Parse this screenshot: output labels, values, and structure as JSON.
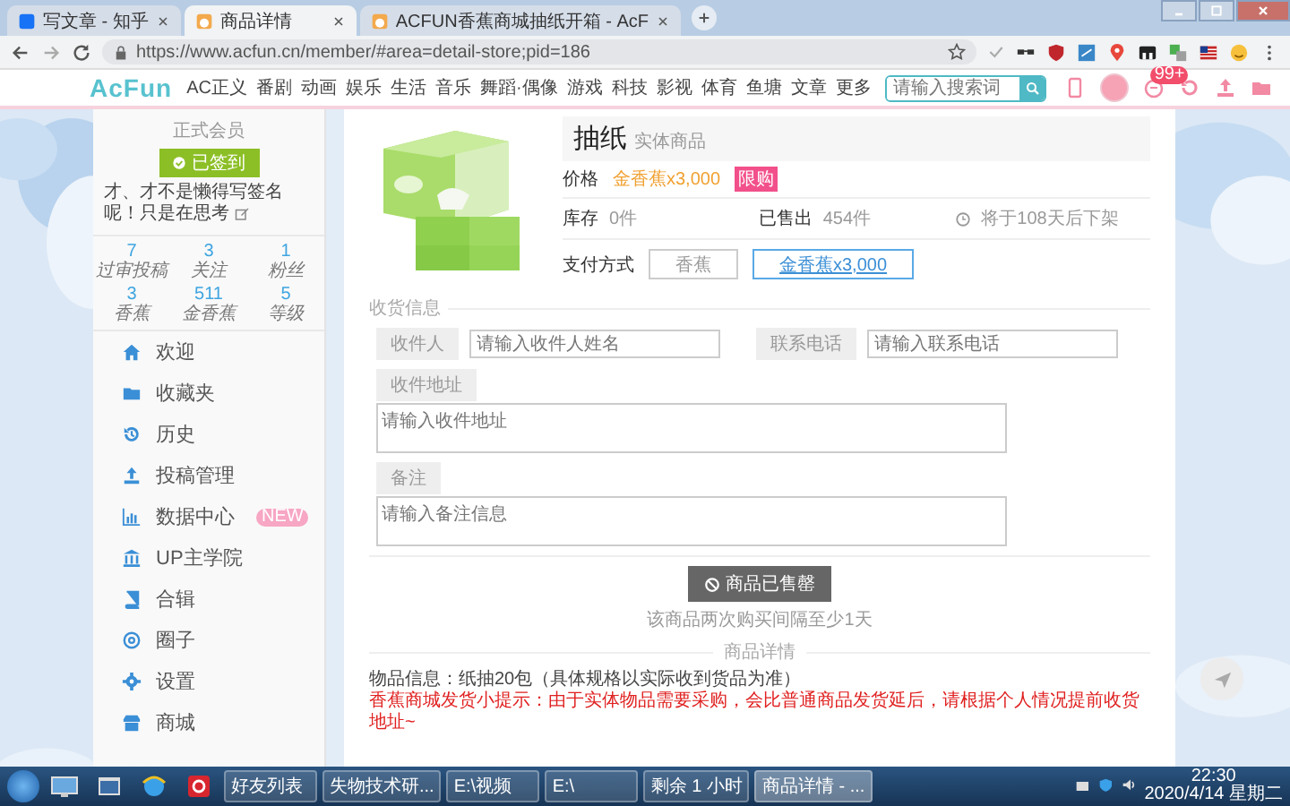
{
  "browser": {
    "tabs": [
      {
        "label": "写文章 - 知乎",
        "selected": false
      },
      {
        "label": "商品详情",
        "selected": true
      },
      {
        "label": "ACFUN香蕉商城抽纸开箱 - AcF",
        "selected": false
      }
    ],
    "url": "https://www.acfun.cn/member/#area=detail-store;pid=186"
  },
  "site_nav": {
    "logo": "AcFun",
    "items": [
      "AC正义",
      "番剧",
      "动画",
      "娱乐",
      "生活",
      "音乐",
      "舞蹈·偶像",
      "游戏",
      "科技",
      "影视",
      "体育",
      "鱼塘",
      "文章",
      "更多"
    ],
    "search": {
      "placeholder": "请输入搜索词"
    },
    "message_badge": "99+"
  },
  "sidebar": {
    "member_level": "正式会员",
    "checkin_button": "已签到",
    "bio": "才、才不是懒得写签名呢！只是在思考",
    "stats": [
      {
        "value": "7",
        "label": "过审投稿"
      },
      {
        "value": "3",
        "label": "关注"
      },
      {
        "value": "1",
        "label": "粉丝"
      },
      {
        "value": "3",
        "label": "香蕉"
      },
      {
        "value": "511",
        "label": "金香蕉"
      },
      {
        "value": "5",
        "label": "等级"
      }
    ],
    "menu": [
      {
        "label": "欢迎"
      },
      {
        "label": "收藏夹"
      },
      {
        "label": "历史"
      },
      {
        "label": "投稿管理"
      },
      {
        "label": "数据中心",
        "badge": "NEW"
      },
      {
        "label": "UP主学院"
      },
      {
        "label": "合辑"
      },
      {
        "label": "圈子"
      },
      {
        "label": "设置"
      },
      {
        "label": "商城"
      }
    ]
  },
  "product": {
    "title": "抽纸",
    "tag": "实体商品",
    "price_label": "价格",
    "price": "金香蕉x3,000",
    "price_badge": "限购",
    "stock_label": "库存",
    "stock": "0件",
    "sold_label": "已售出",
    "sold": "454件",
    "shelf_note": "将于108天后下架",
    "pay_label": "支付方式",
    "pay_options": [
      {
        "label": "香蕉",
        "selected": false
      },
      {
        "label": "金香蕉x3,000",
        "selected": true
      }
    ]
  },
  "shipping": {
    "heading": "收货信息",
    "recipient": {
      "label": "收件人",
      "placeholder": "请输入收件人姓名"
    },
    "phone": {
      "label": "联系电话",
      "placeholder": "请输入联系电话"
    },
    "address": {
      "label": "收件地址",
      "placeholder": "请输入收件地址"
    },
    "note": {
      "label": "备注",
      "placeholder": "请输入备注信息"
    }
  },
  "purchase": {
    "button": "商品已售罄",
    "hint": "该商品两次购买间隔至少1天"
  },
  "details": {
    "heading": "商品详情",
    "info": "物品信息：纸抽20包（具体规格以实际收到货品为准）",
    "notice": "香蕉商城发货小提示：由于实体物品需要采购，会比普通商品发货延后，请根据个人情况提前收货地址~"
  },
  "taskbar": {
    "windows": [
      {
        "label": "好友列表",
        "selected": false
      },
      {
        "label": "失物技术研...",
        "selected": false
      },
      {
        "label": "E:\\视频",
        "selected": false
      },
      {
        "label": "E:\\",
        "selected": false
      },
      {
        "label": "剩余 1 小时",
        "selected": false
      },
      {
        "label": "商品详情 - ...",
        "selected": true
      }
    ],
    "time": "22:30",
    "date": "2020/4/14 星期二"
  }
}
